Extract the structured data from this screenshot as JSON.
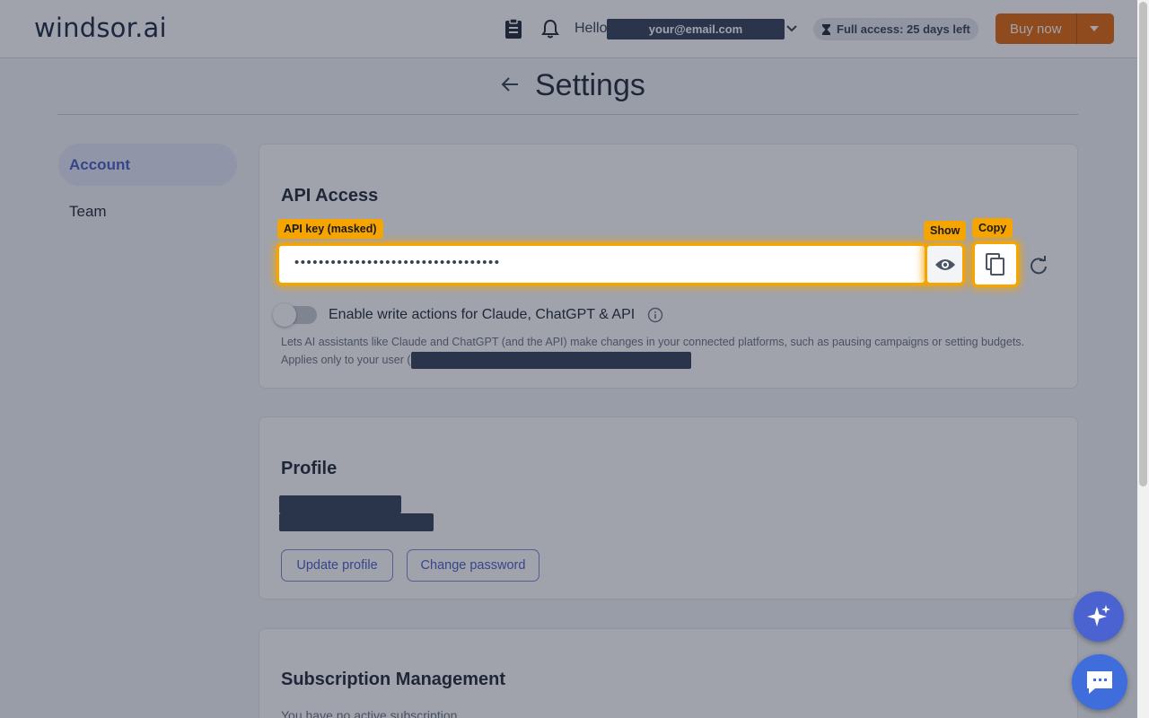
{
  "header": {
    "logo": "windsor.ai",
    "hello": "Hello",
    "email": "your@email.com",
    "access_badge": "Full access: 25 days left",
    "buy_label": "Buy now"
  },
  "page": {
    "title": "Settings"
  },
  "sidebar": {
    "items": [
      {
        "label": "Account",
        "active": true
      },
      {
        "label": "Team",
        "active": false
      }
    ]
  },
  "api_access": {
    "heading": "API Access",
    "key_value": "••••••••••••••••••••••••••••••••••",
    "write_toggle_label": "Enable write actions for Claude, ChatGPT & API",
    "write_toggle_on": false,
    "help_text": "Lets AI assistants like Claude and ChatGPT (and the API) make changes in your connected platforms, such as pausing campaigns or setting budgets.",
    "help_text_2": "Applies only to your user ("
  },
  "profile": {
    "heading": "Profile",
    "update_label": "Update profile",
    "change_password_label": "Change password"
  },
  "subscription": {
    "heading": "Subscription Management",
    "status_text": "You have no active subscription"
  },
  "annotations": {
    "api_key": "API key (masked)",
    "show": "Show",
    "copy": "Copy"
  },
  "colors": {
    "accent": "#4b5fc5",
    "buy": "#e2670c",
    "highlight": "#f6a400",
    "redaction": "#34425b"
  }
}
